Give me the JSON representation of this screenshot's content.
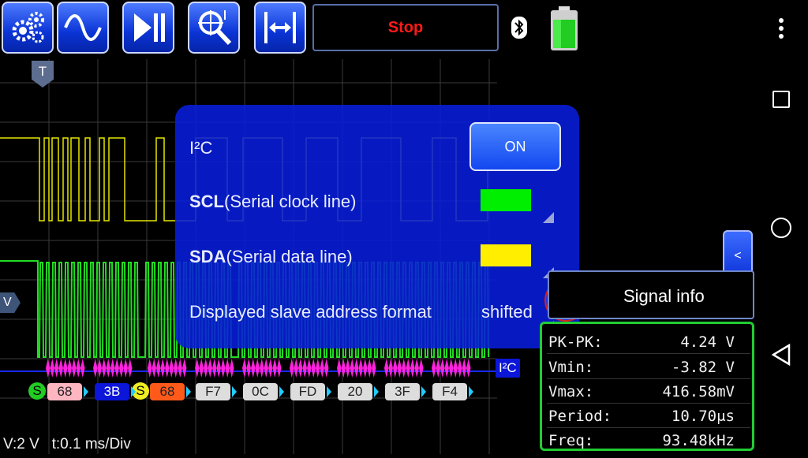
{
  "toolbar": {
    "buttons": [
      {
        "name": "settings-button",
        "icon": "gears-icon"
      },
      {
        "name": "waveform-button",
        "icon": "sine-wave-icon"
      },
      {
        "name": "run-pause-button",
        "icon": "play-pause-icon"
      },
      {
        "name": "cursor-zoom-button",
        "icon": "crosshair-magnifier-icon"
      },
      {
        "name": "fit-width-button",
        "icon": "expand-horizontal-icon"
      }
    ],
    "status_label": "Stop",
    "status_color": "#ff1a1a",
    "bluetooth_icon": "bluetooth-icon",
    "battery_icon": "battery-icon"
  },
  "scope": {
    "trigger_marker": "T",
    "voltage_marker": "V",
    "ch1_color": "#e6e600",
    "ch2_color": "#22dd22",
    "bottom_status": "V:2 V   t:0.1 ms/Div",
    "decode_tag": "I²C"
  },
  "decode": {
    "start_label": "S",
    "start2_label": "S",
    "bytes": [
      {
        "text": "68",
        "color": "#ffb6c1"
      },
      {
        "text": "3B",
        "color": "#0b16d8"
      },
      {
        "text": "68",
        "color": "#ff5a1a"
      },
      {
        "text": "F7",
        "color": "#dddddd"
      },
      {
        "text": "0C",
        "color": "#dddddd"
      },
      {
        "text": "FD",
        "color": "#dddddd"
      },
      {
        "text": "20",
        "color": "#dddddd"
      },
      {
        "text": "3F",
        "color": "#dddddd"
      },
      {
        "text": "F4",
        "color": "#dddddd"
      }
    ]
  },
  "dialog": {
    "title": "I²C",
    "on_label": "ON",
    "scl_bold": "SCL",
    "scl_rest": "(Serial clock line)",
    "scl_color": "#00ee00",
    "sda_bold": "SDA",
    "sda_rest": "(Serial data line)",
    "sda_color": "#ffee00",
    "format_label": "Displayed slave address format",
    "format_value": "shifted"
  },
  "signal_info": {
    "label": "Signal info",
    "collapse_label": "<",
    "anchor_icon": "anchor-icon"
  },
  "measurements": [
    {
      "label": "PK-PK:",
      "value": "4.24 V"
    },
    {
      "label": "Vmin:",
      "value": "-3.82 V"
    },
    {
      "label": "Vmax:",
      "value": "416.58mV"
    },
    {
      "label": "Period:",
      "value": "10.70μs"
    },
    {
      "label": "Freq:",
      "value": "93.48kHz"
    }
  ],
  "navbar": {
    "menu_icon": "more-vert-icon",
    "recents_icon": "square-icon",
    "home_icon": "circle-icon",
    "back_icon": "triangle-back-icon"
  }
}
